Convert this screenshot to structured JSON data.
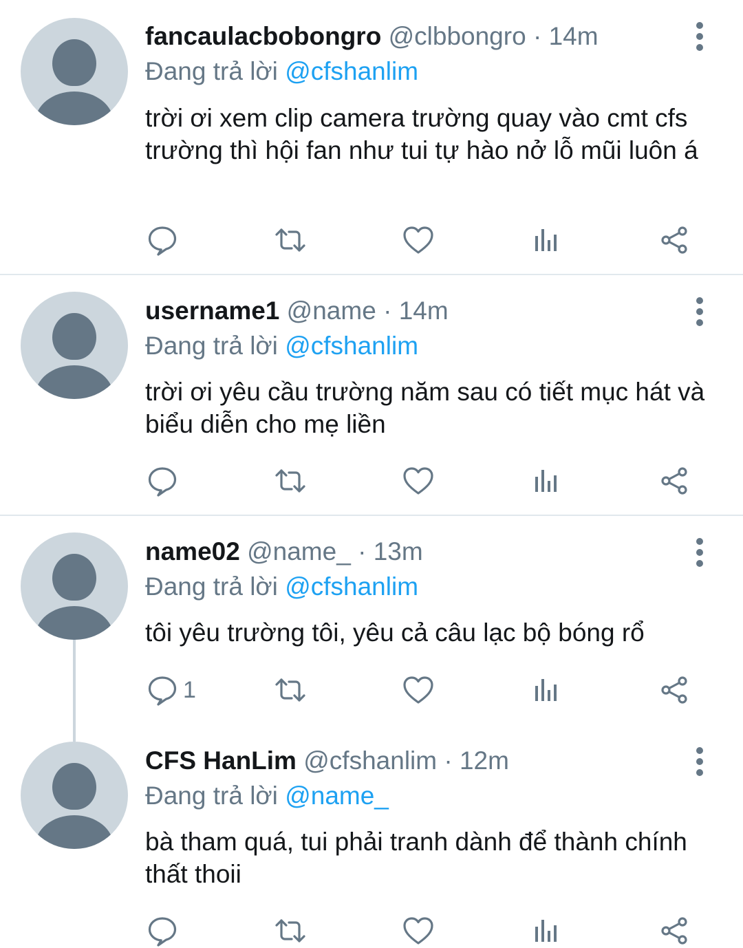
{
  "reply_prefix": "Đang trả lời",
  "tweets": [
    {
      "name": "fancaulacbobongro",
      "handle": "@clbbongro",
      "time": "14m",
      "reply_to": "@cfshanlim",
      "text": "trời ơi xem clip camera trường quay vào cmt cfs trường thì hội fan như tui tự hào nở lỗ mũi luôn á",
      "reply_count": ""
    },
    {
      "name": "username1",
      "handle": "@name",
      "time": "14m",
      "reply_to": "@cfshanlim",
      "text": "trời ơi yêu cầu trường năm sau có tiết mục hát và biểu diễn cho mẹ liền",
      "reply_count": ""
    },
    {
      "name": "name02",
      "handle": "@name_",
      "time": "13m",
      "reply_to": "@cfshanlim",
      "text": "tôi yêu trường tôi, yêu cả câu lạc bộ bóng rổ",
      "reply_count": "1"
    },
    {
      "name": "CFS HanLim",
      "handle": "@cfshanlim",
      "time": "12m",
      "reply_to": "@name_",
      "text": "bà tham quá, tui phải tranh dành để thành chính thất thoii",
      "reply_count": ""
    }
  ],
  "colors": {
    "accent": "#1da1f2",
    "secondary_text": "#657786",
    "avatar_bg": "#ccd6dd",
    "divider": "#e1e8ed"
  },
  "icons": [
    "reply-icon",
    "retweet-icon",
    "like-icon",
    "analytics-icon",
    "share-icon",
    "more-icon",
    "default-avatar-icon"
  ]
}
